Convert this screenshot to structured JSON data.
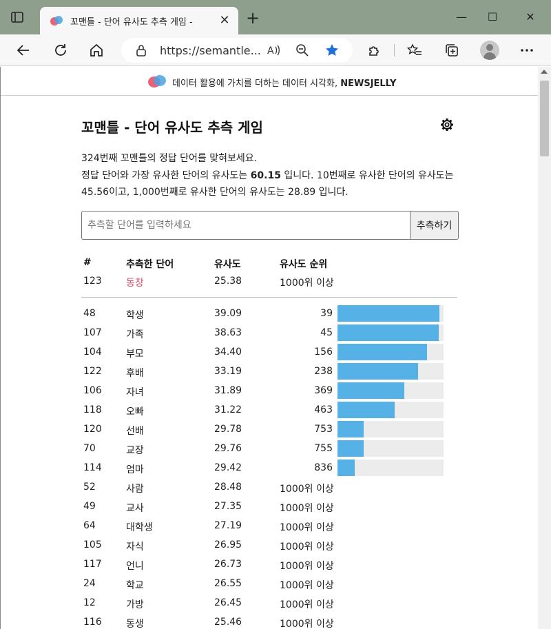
{
  "browser": {
    "tab_title": "꼬맨틀 - 단어 유사도 추측 게임 -",
    "tab_close": "✕",
    "new_tab": "+",
    "address_url": "https://semantle...",
    "minimize": "—",
    "maximize": "☐",
    "close": "✕"
  },
  "banner": {
    "text": "데이터 활용에 가치를 더하는 데이터 시각화,",
    "brand": "NEWSJELLY"
  },
  "game": {
    "title": "꼬맨틀 - 단어 유사도 추측 게임",
    "desc_line1": "324번째 꼬맨틀의 정답 단어를 맞혀보세요.",
    "desc_line2_a": "정답 단어와 가장 유사한 단어의 유사도는 ",
    "top_similarity": "60.15",
    "desc_line2_b": " 입니다. 10번째로 유사한 단어의 유사도는",
    "desc_line3": "45.56이고, 1,000번째로 유사한 단어의 유사도는 28.89 입니다.",
    "input_placeholder": "추측할 단어를 입력하세요",
    "submit_label": "추측하기"
  },
  "table": {
    "headers": {
      "num": "#",
      "word": "추측한 단어",
      "similarity": "유사도",
      "rank": "유사도 순위"
    },
    "latest": {
      "num": "123",
      "word": "동창",
      "similarity": "25.38",
      "rank": "1000위 이상"
    },
    "rows": [
      {
        "num": "48",
        "word": "학생",
        "similarity": "39.09",
        "rank": "39",
        "progress": 0.961
      },
      {
        "num": "107",
        "word": "가족",
        "similarity": "38.63",
        "rank": "45",
        "progress": 0.955
      },
      {
        "num": "104",
        "word": "부모",
        "similarity": "34.40",
        "rank": "156",
        "progress": 0.844
      },
      {
        "num": "122",
        "word": "후배",
        "similarity": "33.19",
        "rank": "238",
        "progress": 0.762
      },
      {
        "num": "106",
        "word": "자녀",
        "similarity": "31.89",
        "rank": "369",
        "progress": 0.631
      },
      {
        "num": "118",
        "word": "오빠",
        "similarity": "31.22",
        "rank": "463",
        "progress": 0.537
      },
      {
        "num": "120",
        "word": "선배",
        "similarity": "29.78",
        "rank": "753",
        "progress": 0.247
      },
      {
        "num": "70",
        "word": "교장",
        "similarity": "29.76",
        "rank": "755",
        "progress": 0.245
      },
      {
        "num": "114",
        "word": "엄마",
        "similarity": "29.42",
        "rank": "836",
        "progress": 0.164
      },
      {
        "num": "52",
        "word": "사람",
        "similarity": "28.48",
        "rank": "1000위 이상"
      },
      {
        "num": "49",
        "word": "교사",
        "similarity": "27.35",
        "rank": "1000위 이상"
      },
      {
        "num": "64",
        "word": "대학생",
        "similarity": "27.19",
        "rank": "1000위 이상"
      },
      {
        "num": "105",
        "word": "자식",
        "similarity": "26.95",
        "rank": "1000위 이상"
      },
      {
        "num": "117",
        "word": "언니",
        "similarity": "26.73",
        "rank": "1000위 이상"
      },
      {
        "num": "24",
        "word": "학교",
        "similarity": "26.55",
        "rank": "1000위 이상"
      },
      {
        "num": "12",
        "word": "가방",
        "similarity": "26.45",
        "rank": "1000위 이상"
      },
      {
        "num": "116",
        "word": "동생",
        "similarity": "25.46",
        "rank": "1000위 이상"
      }
    ]
  },
  "colors": {
    "accent_word": "#d44f6c",
    "bar_fill": "#56b2e6",
    "bar_track": "#ececec",
    "titlebar": "#8f9f8e"
  }
}
